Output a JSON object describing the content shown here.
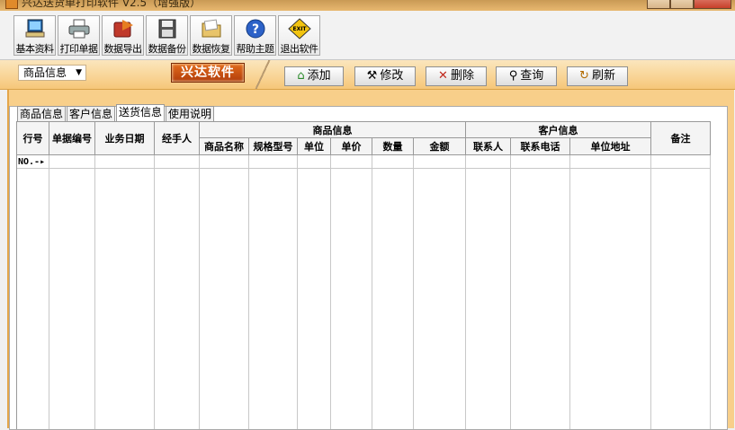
{
  "window": {
    "title": "兴达送货单打印软件 V2.5（增强版）"
  },
  "toolbar": [
    {
      "label": "基本资料",
      "icon": "basic-data-icon"
    },
    {
      "label": "打印单据",
      "icon": "printer-icon"
    },
    {
      "label": "数据导出",
      "icon": "export-icon"
    },
    {
      "label": "数据备份",
      "icon": "floppy-disk-icon"
    },
    {
      "label": "数据恢复",
      "icon": "folder-restore-icon"
    },
    {
      "label": "帮助主题",
      "icon": "help-icon"
    },
    {
      "label": "退出软件",
      "icon": "exit-icon"
    }
  ],
  "category_select": {
    "value": "商品信息"
  },
  "brand": "兴达软件",
  "actions": {
    "add": "添加",
    "edit": "修改",
    "delete": "删除",
    "query": "查询",
    "refresh": "刷新"
  },
  "tabs": [
    "商品信息",
    "客户信息",
    "送货信息",
    "使用说明"
  ],
  "active_tab": "送货信息",
  "table": {
    "columns": {
      "row_no": "行号",
      "doc_no": "单据编号",
      "biz_date": "业务日期",
      "handler": "经手人",
      "goods_group": "商品信息",
      "goods_name": "商品名称",
      "spec": "规格型号",
      "unit": "单位",
      "price": "单价",
      "qty": "数量",
      "amount": "金额",
      "customer_group": "客户信息",
      "contact": "联系人",
      "phone": "联系电话",
      "address": "单位地址",
      "remark": "备注"
    },
    "first_row_label": "NO.-▸"
  },
  "colors": {
    "accent_orange": "#f6c779",
    "brand_red": "#c84a12"
  }
}
